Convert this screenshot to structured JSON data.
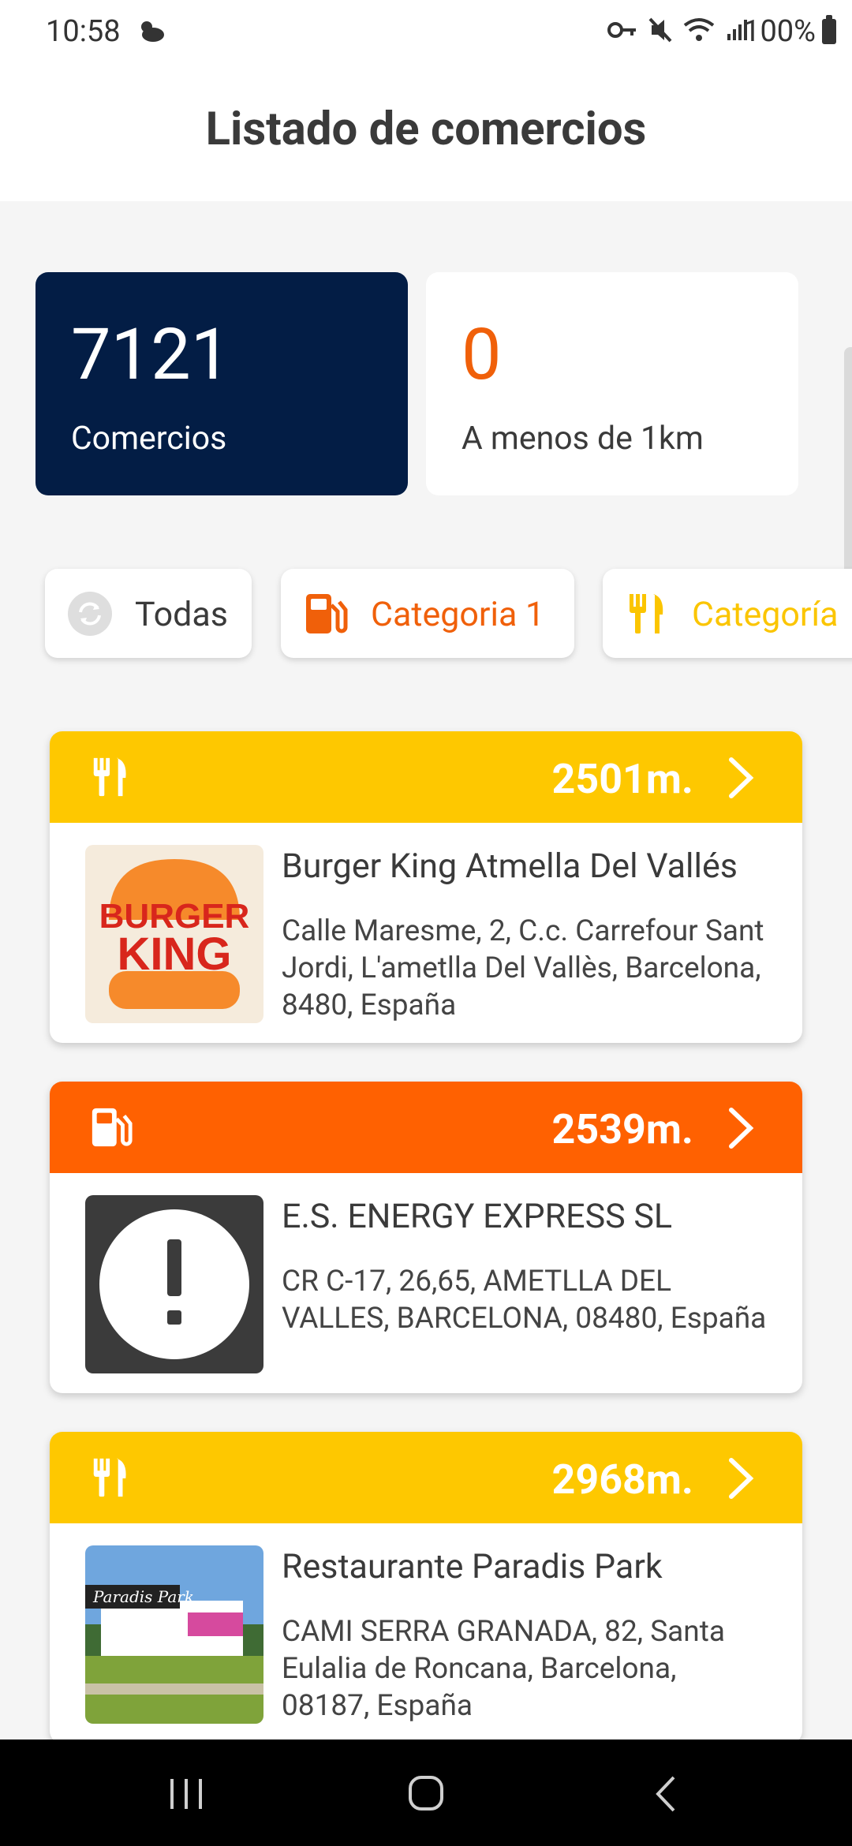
{
  "status_bar": {
    "time": "10:58",
    "battery": "100%",
    "icons": [
      "weather-icon",
      "vpn-key-icon",
      "mute-icon",
      "wifi-icon",
      "signal-icon",
      "battery-icon"
    ]
  },
  "header": {
    "title": "Listado de comercios"
  },
  "stats": {
    "total_value": "7121",
    "total_label": "Comercios",
    "near_value": "0",
    "near_label": "A menos de 1km"
  },
  "filters": [
    {
      "label": "Todas",
      "icon": "refresh-icon"
    },
    {
      "label": "Categoria 1",
      "icon": "fuel-pump-icon"
    },
    {
      "label": "Categoría",
      "icon": "restaurant-icon"
    }
  ],
  "colors": {
    "navy": "#031d45",
    "orange": "#ff6101",
    "yellow": "#fec800",
    "bk_background": "#f5ebdc",
    "bk_red": "#d8261c",
    "bk_bun": "#f68a2b"
  },
  "businesses": [
    {
      "distance": "2501m.",
      "category_icon": "restaurant-icon",
      "name": "Burger King Atmella Del Vallés",
      "address": "Calle Maresme, 2, C.c. Carrefour Sant Jordi, L'ametlla Del Vallès, Barcelona, 8480, España",
      "logo_text_1": "BURGER",
      "logo_text_2": "KING"
    },
    {
      "distance": "2539m.",
      "category_icon": "fuel-pump-icon",
      "name": "E.S. ENERGY EXPRESS SL",
      "address": "CR C-17, 26,65, AMETLLA DEL VALLES, BARCELONA, 08480, España"
    },
    {
      "distance": "2968m.",
      "category_icon": "restaurant-icon",
      "name": "Restaurante Paradis Park",
      "address": "CAMI SERRA GRANADA, 82, Santa Eulalia de Roncana, Barcelona, 08187, España",
      "photo_sign_text": "Paradis Park"
    }
  ],
  "nav_bar": {
    "buttons": [
      "recent-apps-button",
      "home-button",
      "back-button"
    ]
  }
}
